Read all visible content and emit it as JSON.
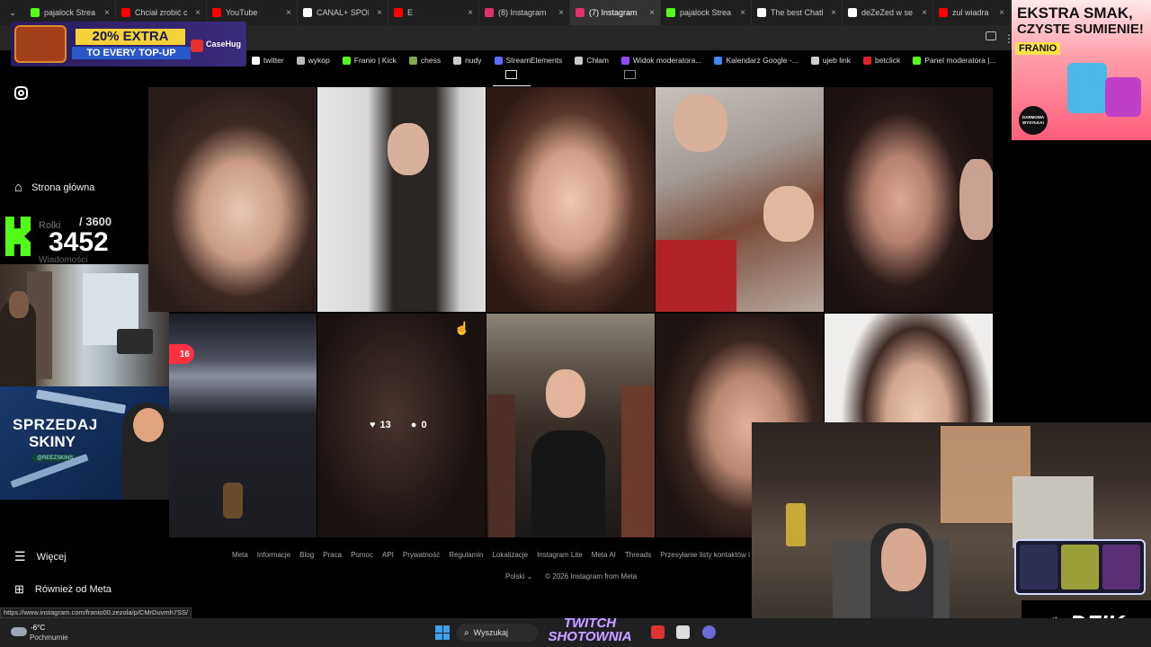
{
  "tabs": [
    {
      "label": "pajalock Strea",
      "color": "#53fc18",
      "active": false
    },
    {
      "label": "Chciał zrobić c",
      "color": "#ff0000",
      "active": false
    },
    {
      "label": "YouTube",
      "color": "#ff0000",
      "active": false
    },
    {
      "label": "CANAL+ SPOR",
      "color": "#ffffff",
      "active": false
    },
    {
      "label": "E",
      "color": "#ff0000",
      "active": false
    },
    {
      "label": "(8) Instagram",
      "color": "#e1306c",
      "active": false
    },
    {
      "label": "(7) Instagram",
      "color": "#e1306c",
      "active": true
    },
    {
      "label": "pajalock Strea",
      "color": "#53fc18",
      "active": false
    },
    {
      "label": "The best Chatb",
      "color": "#ffffff",
      "active": false
    },
    {
      "label": "deZeZed w se",
      "color": "#ffffff",
      "active": false
    },
    {
      "label": "zul wiadra - Yo",
      "color": "#ff0000",
      "active": false
    }
  ],
  "bookmarks": [
    {
      "label": "twitter",
      "color": "#ffffff"
    },
    {
      "label": "wykop",
      "color": "#bbbbbb"
    },
    {
      "label": "Franio | Kick",
      "color": "#53fc18"
    },
    {
      "label": "chess",
      "color": "#7fa650"
    },
    {
      "label": "nudy",
      "color": "#cccccc"
    },
    {
      "label": "StreamElements",
      "color": "#5c6cff"
    },
    {
      "label": "Chłam",
      "color": "#cccccc"
    },
    {
      "label": "Widok moderatora...",
      "color": "#9146ff"
    },
    {
      "label": "Kalendarz Google -...",
      "color": "#4285f4"
    },
    {
      "label": "ujeb link",
      "color": "#cccccc"
    },
    {
      "label": "betclick",
      "color": "#e0202a"
    },
    {
      "label": "Panel moderatora |...",
      "color": "#53fc18"
    }
  ],
  "ads": {
    "casehug_promo": "20% EXTRA",
    "casehug_promo2": "TO EVERY TOP-UP",
    "casehug_brand": "CaseHug",
    "franio_headline1": "EKSTRA SMAK,",
    "franio_headline2": "CZYSTE SUMIENIE!",
    "franio_brand": "FRANIO",
    "franio_badge": "DARMOWA WYSYŁKA!",
    "skiny_line1": "SPRZEDAJ",
    "skiny_line2": "SKINY",
    "skiny_brand": "@REEZSKINS",
    "dzik": "DZIK",
    "twitch_line1": "TWITCH",
    "twitch_line2": "SHOTOWNIA"
  },
  "sidebar": {
    "home": "Strona główna",
    "reels": "Rolki",
    "messages": "Wiadomości",
    "more": "Więcej",
    "also_meta": "Również od Meta"
  },
  "counter": {
    "current": "3452",
    "goal": "/ 3600"
  },
  "grid": {
    "pinned_badge": "16",
    "hover_likes": "13",
    "hover_comments": "0"
  },
  "footer": {
    "links": [
      "Meta",
      "Informacje",
      "Blog",
      "Praca",
      "Pomoc",
      "API",
      "Prywatność",
      "Regulamin",
      "Lokalizacje",
      "Instagram Lite",
      "Meta AI",
      "Threads",
      "Przesyłanie listy kontaktów i"
    ],
    "language": "Polski",
    "copyright": "© 2026 Instagram from Meta"
  },
  "status_url": "https://www.instagram.com/franio00.zezola/p/CMrDuvmh7SS/",
  "taskbar": {
    "temperature": "-6°C",
    "weather": "Pochmurnie",
    "search": "Wyszukaj"
  },
  "colors": {
    "instagram_red": "#ff3040",
    "kick_green": "#53fc18",
    "taskbar_bg": "#202020"
  }
}
